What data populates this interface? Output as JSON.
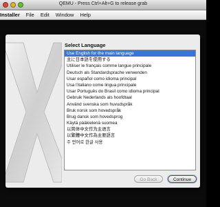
{
  "window": {
    "title": "QEMU - Press Ctrl+Alt+G to release grab"
  },
  "menubar": {
    "app": "Installer",
    "items": [
      "File",
      "Edit",
      "Window",
      "Help"
    ]
  },
  "panel": {
    "heading": "Select Language",
    "languages": [
      "Use English for the main language",
      "主に日本語を使用する",
      "Utiliser le français comme langue principale",
      "Deutsch als Standardsprache verwenden",
      "Usar español como idioma principal",
      "Usa l'italiano come lingua principale",
      "Usar Português do Brasil como idioma principal",
      "Gebruik Nederlands als hoofdtaal",
      "Använd svenska som huvudspråk",
      "Bruk norsk som hovedspråk",
      "Brug dansk som hovedsprog",
      "Käytä pääkielenä suomea",
      "以简体中文作为主语言",
      "以繁體中文作為主要語言",
      "주 언어로 한글 사용"
    ],
    "selected_index": 0,
    "back_label": "Go Back",
    "continue_label": "Continue"
  },
  "colors": {
    "selection": "#3875d7",
    "panel_bg": "#ececec",
    "desktop": "#0b0b0b"
  }
}
